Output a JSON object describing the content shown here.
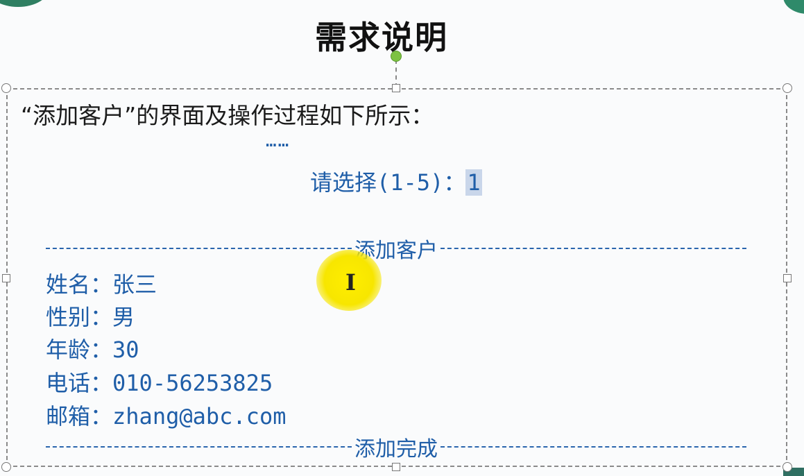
{
  "slide": {
    "title": "需求说明",
    "intro": "“添加客户”的界面及操作过程如下所示：",
    "ellipsis": "……",
    "prompt_label": "请选择(1-5)：",
    "prompt_value": "1",
    "header_divider_label": "添加客户",
    "footer_divider_label": "添加完成",
    "fields": [
      {
        "key": "姓名：",
        "value": "张三"
      },
      {
        "key": "性别：",
        "value": "男"
      },
      {
        "key": "年龄：",
        "value": "30"
      },
      {
        "key": "电话：",
        "value": "010-56253825"
      },
      {
        "key": "邮箱：",
        "value": "zhang@abc.com"
      }
    ]
  },
  "colors": {
    "console_text": "#1f5ea8",
    "highlight": "#ffee00",
    "rotation_handle": "#7dc242"
  },
  "icons": {
    "cursor": "i-beam-cursor-icon",
    "rotate": "rotate-handle-icon"
  }
}
